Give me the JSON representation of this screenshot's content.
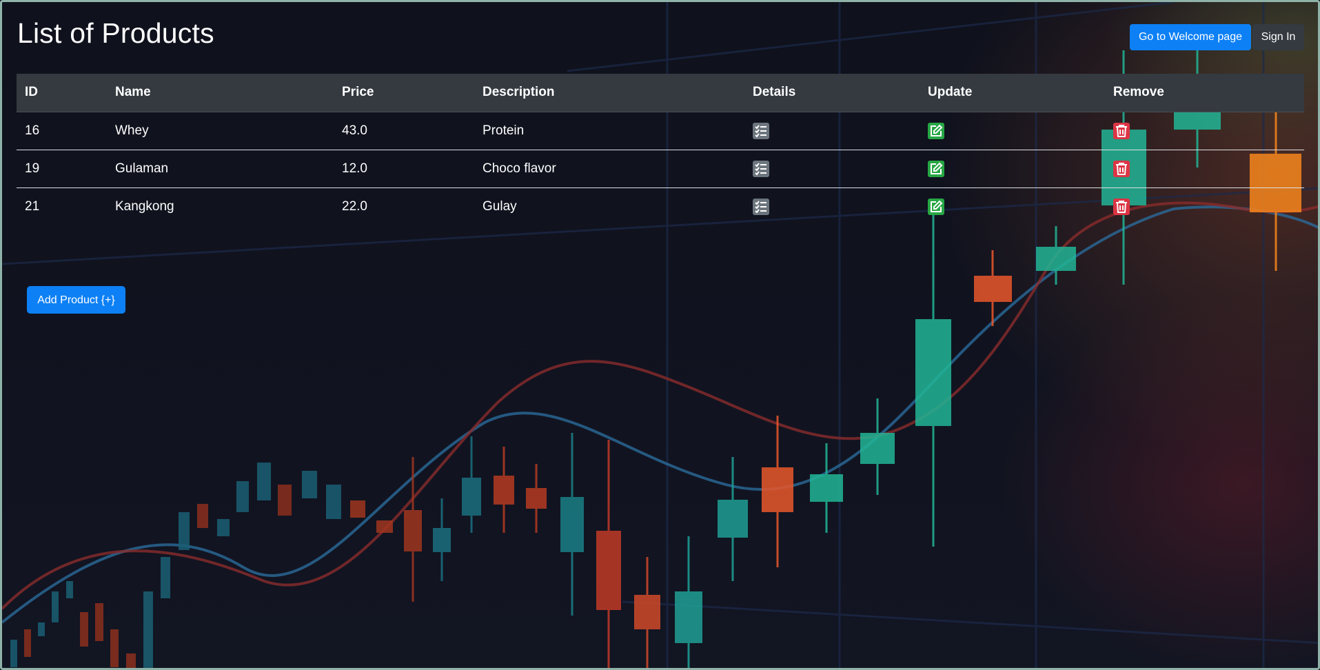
{
  "page": {
    "title": "List of Products"
  },
  "header": {
    "welcome_label": "Go to Welcome page",
    "signin_label": "Sign In"
  },
  "table": {
    "columns": [
      "ID",
      "Name",
      "Price",
      "Description",
      "Details",
      "Update",
      "Remove"
    ],
    "rows": [
      {
        "id": "16",
        "name": "Whey",
        "price": "43.0",
        "description": "Protein"
      },
      {
        "id": "19",
        "name": "Gulaman",
        "price": "12.0",
        "description": "Choco flavor"
      },
      {
        "id": "21",
        "name": "Kangkong",
        "price": "22.0",
        "description": "Gulay"
      }
    ],
    "row_icons": {
      "details": "list-check-icon",
      "update": "edit-icon",
      "remove": "trash-icon"
    }
  },
  "actions": {
    "add_label": "Add Product {+}"
  },
  "colors": {
    "primary": "#0d80f5",
    "dark": "#343a40",
    "details": "#6c757d",
    "update": "#28a745",
    "remove": "#dc3545"
  }
}
